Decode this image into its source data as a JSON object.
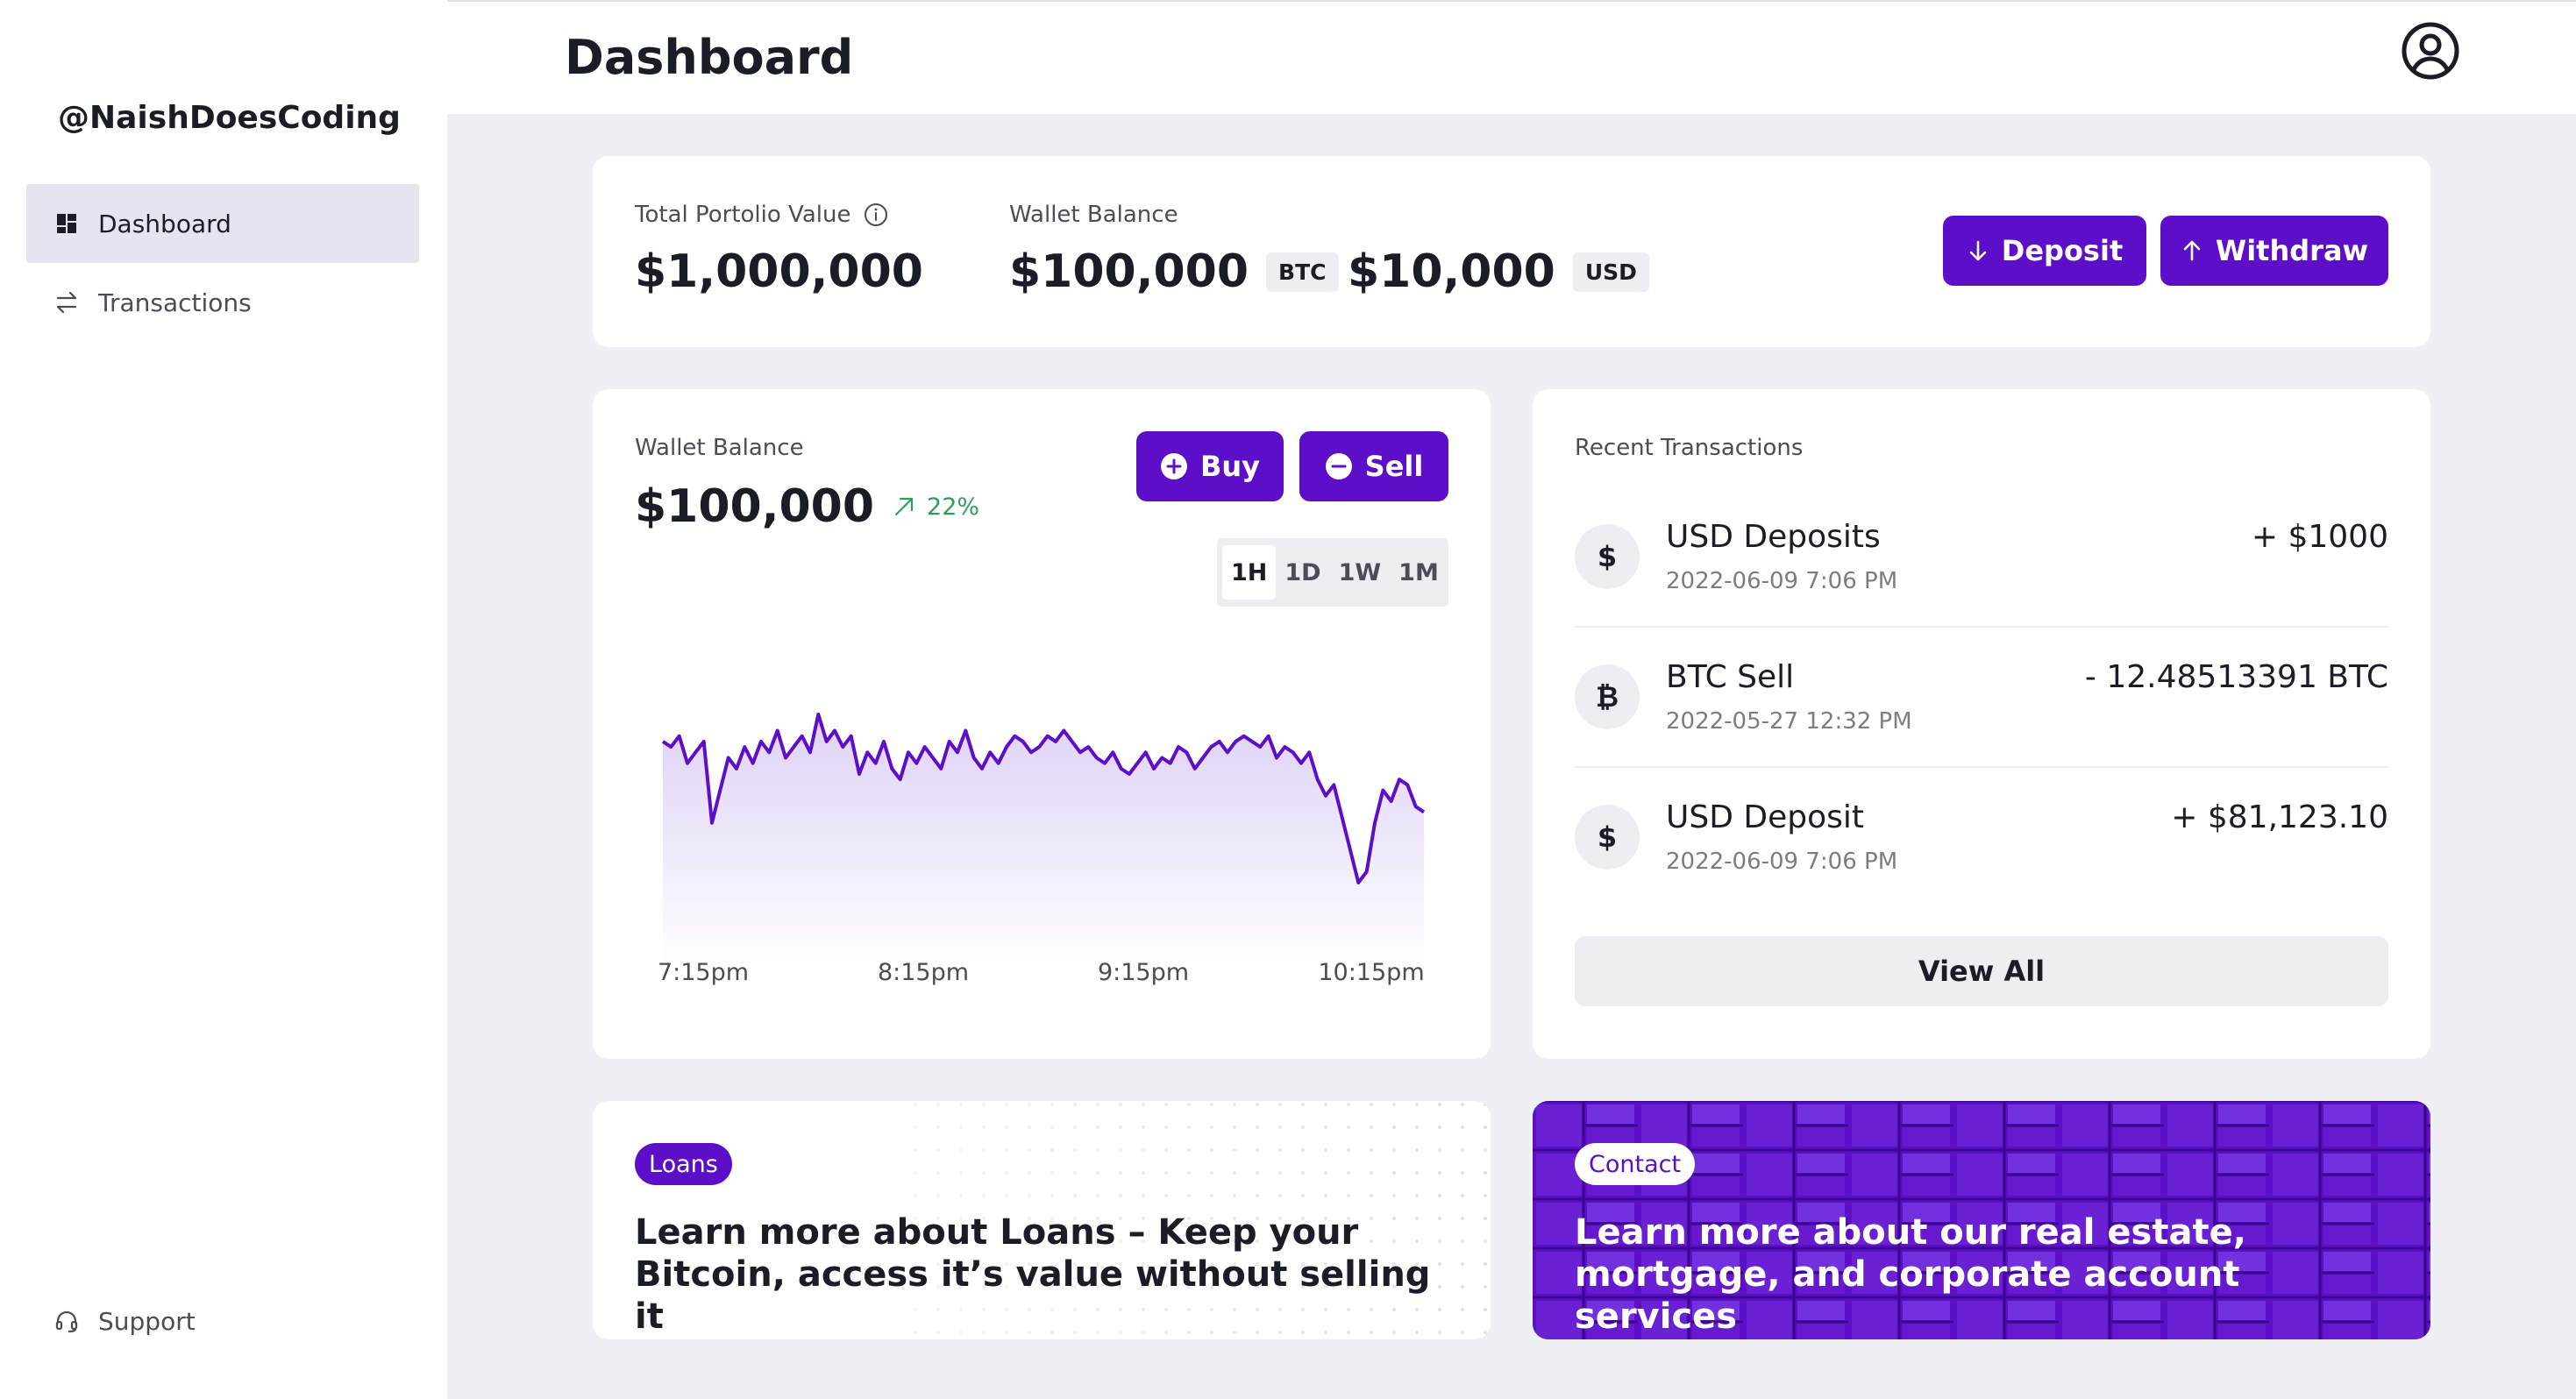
{
  "sidebar": {
    "brand": "@NaishDoesCoding",
    "items": [
      {
        "label": "Dashboard",
        "icon": "dashboard-grid-icon",
        "active": true
      },
      {
        "label": "Transactions",
        "icon": "arrows-swap-icon",
        "active": false
      }
    ],
    "support": {
      "label": "Support",
      "icon": "headset-icon"
    }
  },
  "header": {
    "title": "Dashboard",
    "avatar_icon": "user-circle-icon"
  },
  "summary": {
    "total_label": "Total Portolio Value",
    "total_value": "$1,000,000",
    "info_icon": "info-icon",
    "wallet_label": "Wallet Balance",
    "btc_value": "$100,000",
    "btc_badge": "BTC",
    "usd_value": "$10,000",
    "usd_badge": "USD",
    "deposit_label": "Deposit",
    "withdraw_label": "Withdraw"
  },
  "wallet_chart": {
    "label": "Wallet Balance",
    "value": "$100,000",
    "change": "22%",
    "buy_label": "Buy",
    "sell_label": "Sell",
    "timeframes": [
      "1H",
      "1D",
      "1W",
      "1M"
    ],
    "active_timeframe": "1H"
  },
  "chart_data": {
    "type": "area",
    "x_ticks": [
      "7:15pm",
      "8:15pm",
      "9:15pm",
      "10:15pm"
    ],
    "series": [
      {
        "color": "#5c0ec9",
        "values": [
          62,
          61,
          63,
          58,
          60,
          62,
          47,
          53,
          59,
          57,
          61,
          58,
          62,
          60,
          64,
          59,
          61,
          63,
          60,
          67,
          62,
          64,
          61,
          63,
          56,
          60,
          58,
          62,
          57,
          55,
          60,
          58,
          61,
          59,
          57,
          62,
          60,
          64,
          59,
          57,
          60,
          58,
          61,
          63,
          62,
          60,
          61,
          63,
          62,
          64,
          62,
          60,
          61,
          59,
          58,
          60,
          57,
          56,
          58,
          60,
          57,
          59,
          58,
          61,
          60,
          57,
          59,
          61,
          62,
          60,
          62,
          63,
          62,
          61,
          63,
          59,
          61,
          60,
          58,
          60,
          55,
          52,
          54,
          48,
          42,
          36,
          38,
          47,
          53,
          51,
          55,
          54,
          50,
          49
        ]
      }
    ],
    "grid": false,
    "legend": "none"
  },
  "transactions": {
    "title": "Recent Transactions",
    "items": [
      {
        "icon": "dollar-icon",
        "symbol": "$",
        "title": "USD Deposits",
        "date": "2022-06-09 7:06 PM",
        "amount": "+ $1000"
      },
      {
        "icon": "bitcoin-icon",
        "symbol": "₿",
        "title": "BTC Sell",
        "date": "2022-05-27 12:32 PM",
        "amount": "- 12.48513391 BTC"
      },
      {
        "icon": "dollar-icon",
        "symbol": "$",
        "title": "USD Deposit",
        "date": "2022-06-09 7:06 PM",
        "amount": "+ $81,123.10"
      }
    ],
    "view_all_label": "View All"
  },
  "promos": {
    "loans": {
      "pill": "Loans",
      "text": "Learn more about Loans – Keep your Bitcoin, access it’s value without selling it"
    },
    "contact": {
      "pill": "Contact",
      "text": "Learn more about our real estate, mortgage, and corporate account services"
    }
  },
  "colors": {
    "accent": "#5c0ec9",
    "positive": "#2f9e5d",
    "background": "#eef0f5"
  }
}
